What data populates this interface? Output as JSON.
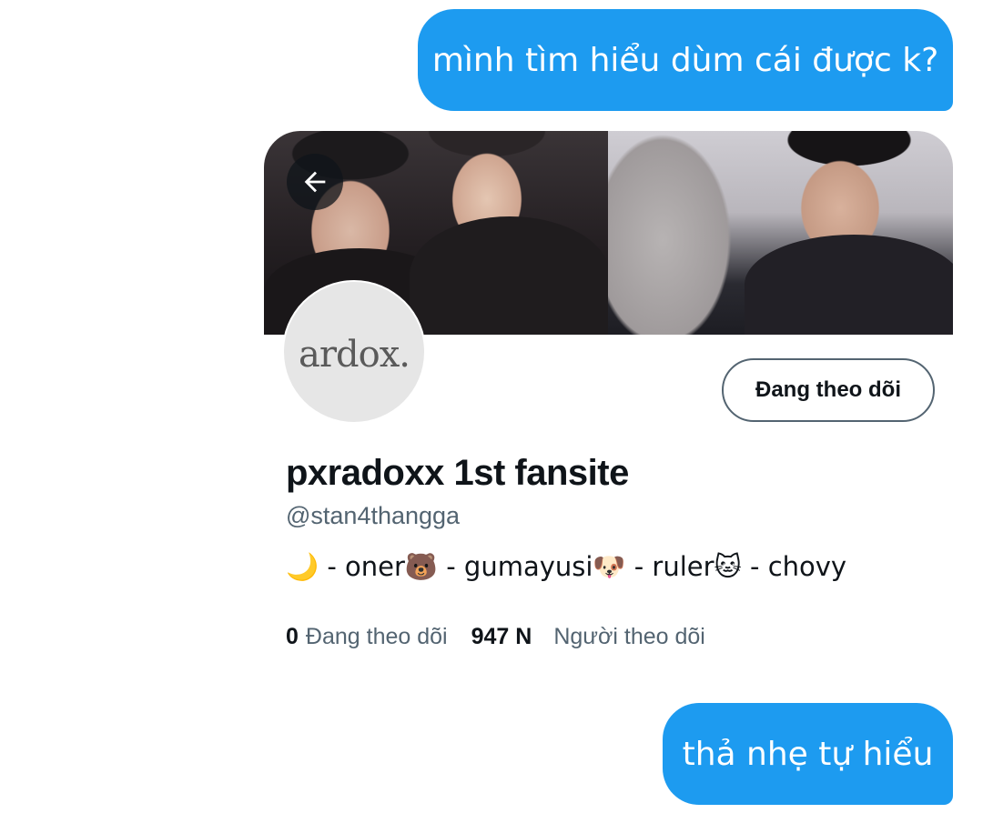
{
  "messages": [
    {
      "text": "mình tìm hiểu dùm cái được k?"
    },
    {
      "text": "thả nhẹ tự hiểu"
    }
  ],
  "profile_card": {
    "back_icon": "arrow-left-icon",
    "avatar_text": "ardox.",
    "follow_button_label": "Đang theo dõi",
    "display_name": "pxradoxx 1st fansite",
    "handle": "@stan4thangga",
    "bio": "🌙 - oner🐻 - gumayusi🐶 - ruler🐱 - chovy",
    "following_count": "0",
    "following_label": "Đang theo dõi",
    "followers_count": "947 N",
    "followers_label": "Người theo dõi"
  },
  "colors": {
    "bubble": "#1d9bf0",
    "primary_text": "#0f1419",
    "secondary_text": "#536471",
    "button_border": "#536471"
  }
}
